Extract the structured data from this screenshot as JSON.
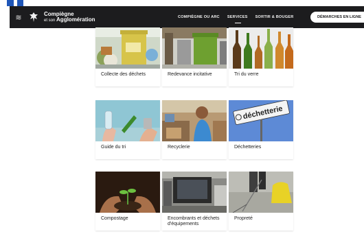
{
  "header": {
    "logo_line1": "Compiègne",
    "logo_prefix": "et son",
    "logo_line2": "Agglomération",
    "nav": [
      {
        "label": "COMPIÈGNE OU ARC"
      },
      {
        "label": "SERVICES"
      },
      {
        "label": "SORTIR & BOUGER"
      }
    ],
    "cta_label": "DÉMARCHES EN LIGNE"
  },
  "tiles": [
    {
      "label": "Collecte des déchets",
      "icon": "recycling-bins-photo"
    },
    {
      "label": "Redevance incitative",
      "icon": "garbage-bins-photo"
    },
    {
      "label": "Tri du verre",
      "icon": "glass-bottles-photo"
    },
    {
      "label": "Guide du tri",
      "icon": "sorting-hands-photo"
    },
    {
      "label": "Recyclerie",
      "icon": "recyclerie-photo"
    },
    {
      "label": "Déchetteries",
      "icon": "dechetterie-sign-photo"
    },
    {
      "label": "Compostage",
      "icon": "compost-seedling-photo"
    },
    {
      "label": "Encombrants et déchets d'équipements",
      "icon": "bulky-waste-photo"
    },
    {
      "label": "Propreté",
      "icon": "cleanliness-photo"
    }
  ],
  "sign_text": "déchetterie",
  "colors": {
    "navbar": "#1c1c1e",
    "accent_blue": "#1f56b8"
  }
}
